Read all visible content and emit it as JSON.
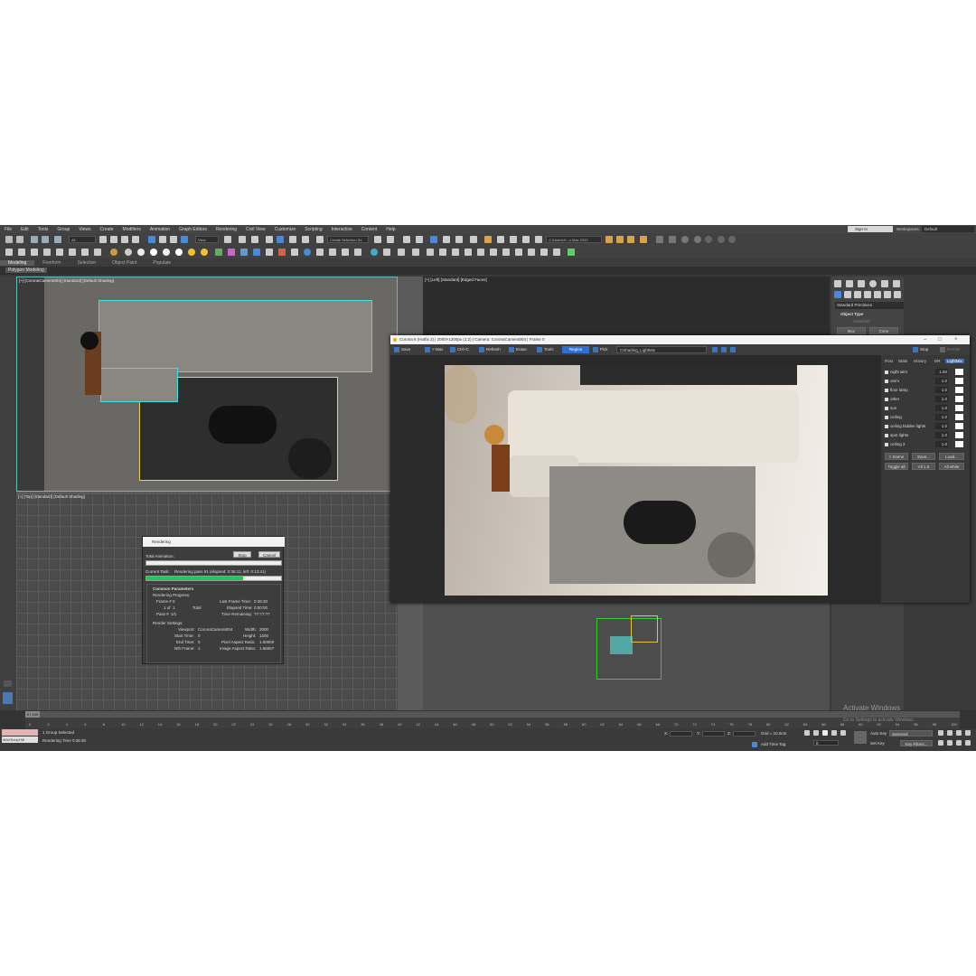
{
  "menu": [
    "File",
    "Edit",
    "Tools",
    "Group",
    "Views",
    "Create",
    "Modifiers",
    "Animation",
    "Graph Editors",
    "Rendering",
    "Civil View",
    "Customize",
    "Scripting",
    "Interactive",
    "Content",
    "Help"
  ],
  "account": {
    "sign_in": "Sign In",
    "workspaces_label": "Workspaces:",
    "workspace": "Default"
  },
  "toolbar": {
    "filter": "All",
    "view": "View",
    "selection_set": "Create Selection Se",
    "path": "C:\\Users\\H...s Max 2020"
  },
  "ribbon": {
    "tabs": [
      "Modeling",
      "Freeform",
      "Selection",
      "Object Paint",
      "Populate"
    ],
    "sub": "Polygon Modeling"
  },
  "viewports": {
    "camera": "[+] [CoronaCamera004] [Standard] [Default Shading]",
    "left": "[+] [Left] [Standard] [Edged Faces]",
    "top": "[+] [Top] [Standard] [Default Shading]"
  },
  "command_panel": {
    "category": "Standard Primitives",
    "object_type": "Object Type",
    "autogrid": "AutoGrid",
    "box": "Box",
    "cone": "Cone"
  },
  "vfb": {
    "title": "Corona 6 (Hotfix 2) | 2000×1200px (1:2) | Camera: CoronaCamera004 | Frame 0",
    "stop": "Stop",
    "render": "Render",
    "toolbar": {
      "save": "Save",
      "max": "> Max",
      "ctrlc": "Ctrl+C",
      "refresh": "Refresh",
      "erase": "Erase",
      "tools": "Tools",
      "region": "Region",
      "pick": "Pick",
      "shading": "CShading_LightMix"
    },
    "side_tabs": [
      "Post",
      "Stats",
      "History",
      "DR",
      "LightMix"
    ],
    "lightmix": [
      {
        "name": "night wim",
        "value": "1.50"
      },
      {
        "name": "omni",
        "value": "1.0"
      },
      {
        "name": "floor lamp",
        "value": "1.0"
      },
      {
        "name": "other",
        "value": "1.0"
      },
      {
        "name": "sun",
        "value": "1.0"
      },
      {
        "name": "ceiling",
        "value": "1.0"
      },
      {
        "name": "ceiling hidden lights",
        "value": "1.0"
      },
      {
        "name": "spot lights",
        "value": "1.0"
      },
      {
        "name": "ceiling 2",
        "value": "1.0"
      }
    ],
    "buttons": {
      "scene": "> Scene",
      "save": "Save...",
      "load": "Load...",
      "toggle_all": "Toggle all",
      "all1": "All 1.0",
      "allwhite": "All white"
    }
  },
  "render_dialog": {
    "title": "Rendering",
    "stop": "Stop",
    "cancel": "Cancel",
    "total_animation": "Total Animation:",
    "current_task_label": "Current Task:",
    "current_task": "Rendering pass 91 (elapsed: 0:36:11, left: 0:13:41)",
    "current_progress": 0.72,
    "section": "Common Parameters",
    "progress_head": "Rendering Progress:",
    "frame": "Frame #",
    "frame_val": "0",
    "of": "1 of",
    "of_val": "1",
    "total": "Total",
    "pass": "Pass #",
    "pass_val": "1/1",
    "last_frame_time": "Last Frame Time:",
    "last_frame_time_val": "0:36:30",
    "elapsed": "Elapsed Time:",
    "elapsed_val": "0:00:00",
    "remaining": "Time Remaining:",
    "remaining_val": "??:??:??",
    "settings_head": "Render Settings:",
    "viewport": "Viewport:",
    "viewport_val": "CoronaCamera004",
    "width": "Width:",
    "width_val": "2000",
    "start_time": "Start Time:",
    "start_time_val": "0",
    "height": "Height:",
    "height_val": "1200",
    "end_time": "End Time:",
    "end_time_val": "0",
    "pixel_aspect": "Pixel Aspect Ratio:",
    "pixel_aspect_val": "1.00000",
    "nth_frame": "Nth Frame:",
    "nth_frame_val": "1",
    "image_aspect": "Image Aspect Ratio:",
    "image_aspect_val": "1.66667"
  },
  "timeline": {
    "frame": "0 / 100",
    "ticks": [
      "0",
      "2",
      "4",
      "6",
      "8",
      "10",
      "12",
      "14",
      "16",
      "18",
      "20",
      "22",
      "24",
      "26",
      "28",
      "30",
      "32",
      "34",
      "36",
      "38",
      "40",
      "42",
      "44",
      "46",
      "48",
      "50",
      "52",
      "54",
      "56",
      "58",
      "60",
      "62",
      "64",
      "66",
      "68",
      "70",
      "72",
      "74",
      "76",
      "78",
      "80",
      "82",
      "84",
      "86",
      "88",
      "90",
      "92",
      "94",
      "96",
      "98",
      "100"
    ]
  },
  "status": {
    "maxscript": "MAXScript Mi",
    "selected": "1 Group Selected",
    "render_time": "Rendering Time  0:36:30",
    "x": "X:",
    "y": "Y:",
    "z": "Z:",
    "grid": "Grid = 10.0cm",
    "add_time_tag": "Add Time Tag",
    "auto_key": "Auto Key",
    "selected_sel": "Selected",
    "set_key": "Set Key",
    "key_filters": "Key Filters...",
    "frame_field": "0"
  },
  "watermark": {
    "line1": "Activate Windows",
    "line2": "Go to Settings to activate Windows."
  },
  "colors": {
    "accent_blue": "#2f6fd1",
    "selection_cyan": "#40e0e0",
    "progress_green": "#22c55e",
    "bg": "#3a3a3a"
  }
}
